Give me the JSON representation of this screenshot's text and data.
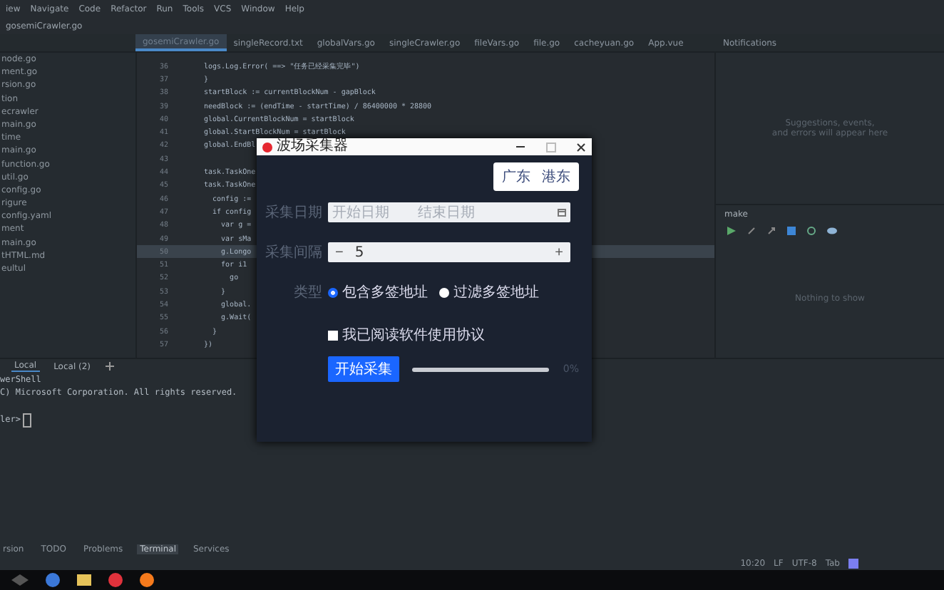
{
  "menu_bar": {
    "items": [
      "iew",
      "Navigate",
      "Code",
      "Refactor",
      "Run",
      "Tools",
      "VCS",
      "Window",
      "Help"
    ]
  },
  "breadcrumb": "gosemiCrawler.go",
  "editor_tabs": [
    {
      "label": "gosemiCrawler.go",
      "selected": true
    },
    {
      "label": "singleRecord.txt",
      "selected": false
    },
    {
      "label": "globalVars.go",
      "selected": false
    },
    {
      "label": "singleCrawler.go",
      "selected": false
    },
    {
      "label": "fileVars.go",
      "selected": false
    },
    {
      "label": "file.go",
      "selected": false
    },
    {
      "label": "cacheyuan.go",
      "selected": false
    },
    {
      "label": "App.vue",
      "selected": false
    }
  ],
  "project_files": [
    "node.go",
    "ment.go",
    "rsion.go",
    "tion",
    "ecrawler",
    "main.go",
    "time",
    "main.go",
    "function.go",
    "util.go",
    "config.go",
    "rigure",
    "config.yaml",
    "ment",
    "main.go",
    "tHTML.md",
    "eultul"
  ],
  "code": {
    "lines": [
      {
        "number": "36",
        "text": "logs.Log.Error( ==> \"任务已经采集完毕\")",
        "current": false
      },
      {
        "number": "37",
        "text": "}",
        "current": false
      },
      {
        "number": "38",
        "text": "startBlock := currentBlockNum - gapBlock",
        "current": false
      },
      {
        "number": "39",
        "text": "needBlock := (endTime - startTime) / 86400000 * 28800",
        "current": false
      },
      {
        "number": "40",
        "text": "global.CurrentBlockNum = startBlock",
        "current": false
      },
      {
        "number": "41",
        "text": "global.StartBlockNum = startBlock",
        "current": false
      },
      {
        "number": "42",
        "text": "global.EndBl",
        "current": false
      },
      {
        "number": "43",
        "current": false
      },
      {
        "number": "44",
        "text": "task.TaskOne",
        "current": false
      },
      {
        "number": "45",
        "text": "task.TaskOne",
        "current": false
      },
      {
        "number": "46",
        "text": "  config :=",
        "current": false
      },
      {
        "number": "47",
        "text": "  if config",
        "current": false
      },
      {
        "number": "48",
        "text": "    var g =",
        "current": false
      },
      {
        "number": "49",
        "text": "    var sMa",
        "current": false
      },
      {
        "number": "50",
        "text": "    g.Longo",
        "current": true
      },
      {
        "number": "51",
        "text": "    for i1",
        "current": false
      },
      {
        "number": "52",
        "text": "      go",
        "current": false
      },
      {
        "number": "53",
        "text": "    }",
        "current": false
      },
      {
        "number": "54",
        "text": "    global.",
        "current": false
      },
      {
        "number": "55",
        "text": "    g.Wait(",
        "current": false
      },
      {
        "number": "56",
        "text": "  }",
        "current": false
      },
      {
        "number": "57",
        "text": "})",
        "current": false
      }
    ]
  },
  "dialog": {
    "title": "波场采集器",
    "regions": [
      {
        "label": "广东",
        "selected": false
      },
      {
        "label": "港东",
        "selected": false
      }
    ],
    "date_label": "采集日期",
    "start_placeholder": "开始日期",
    "end_placeholder": "结束日期",
    "interval_label": "采集间隔",
    "interval_value": "5",
    "minus": "−",
    "plus": "+",
    "type_label": "类型",
    "radios": [
      {
        "label": "包含多签地址",
        "selected": true
      },
      {
        "label": "过滤多签地址",
        "selected": false
      }
    ],
    "agreement": {
      "label": "我已阅读软件使用协议",
      "checked": false
    },
    "start_button": "开始采集",
    "progress": {
      "level": 0,
      "reading": "0%"
    }
  },
  "notifications": {
    "title": "Notifications",
    "message_lines": [
      "Suggestions, events,",
      "and errors will appear here"
    ]
  },
  "make_panel": {
    "title": "make",
    "empty_text": "Nothing to show"
  },
  "terminal": {
    "tabs": [
      {
        "label": "Local",
        "selected": true
      },
      {
        "label": "Local (2)",
        "selected": false
      }
    ],
    "lines": [
      "werShell",
      "C) Microsoft Corporation. All rights reserved.",
      "ler>"
    ]
  },
  "tool_tabs": [
    {
      "label": "rsion",
      "selected": false
    },
    {
      "label": "TODO",
      "selected": false
    },
    {
      "label": "Problems",
      "selected": false
    },
    {
      "label": "Terminal",
      "selected": true
    },
    {
      "label": "Services",
      "selected": false
    }
  ],
  "status_bar": {
    "items": [
      "10:20",
      "LF",
      "UTF-8",
      "Tab"
    ]
  }
}
